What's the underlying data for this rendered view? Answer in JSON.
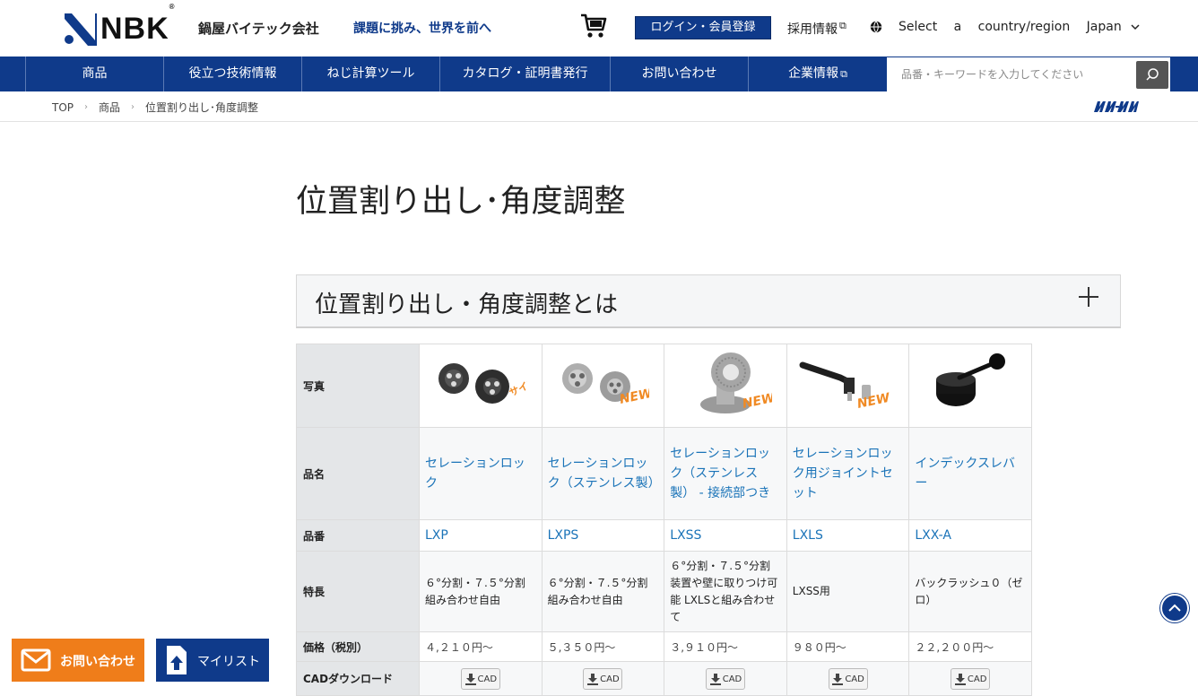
{
  "header": {
    "logo_text": "NBK",
    "logo_mark": "®",
    "company": "鍋屋バイテック会社",
    "tagline": "課題に挑み、世界を前へ",
    "login_label": "ログイン・会員登録",
    "recruit_label": "採用情報",
    "region_label": "Select a country/region",
    "region_value": "Japan"
  },
  "nav": {
    "items": [
      "商品",
      "役立つ技術情報",
      "ねじ計算ツール",
      "カタログ・証明書発行",
      "お問い合わせ",
      "企業情報"
    ],
    "search_placeholder": "品番・キーワードを入力してください"
  },
  "breadcrumb": [
    "TOP",
    "商品",
    "位置割り出し･角度調整"
  ],
  "page": {
    "title": "位置割り出し･角度調整",
    "accordion_title": "位置割り出し・角度調整とは"
  },
  "table": {
    "row_labels": {
      "photo": "写真",
      "name": "品名",
      "code": "品番",
      "feature": "特長",
      "price": "価格（税別）",
      "cad": "CADダウンロード"
    },
    "cad_label": "CAD",
    "products": [
      {
        "badge": "サイズ追加",
        "name": "セレーションロック",
        "code": "LXP",
        "feature": "６°分割・７.５°分割 組み合わせ自由",
        "price": "４,２１０円～"
      },
      {
        "badge": "NEW",
        "name": "セレーションロック（ステンレス製）",
        "code": "LXPS",
        "feature": "６°分割・７.５°分割 組み合わせ自由",
        "price": "５,３５０円～"
      },
      {
        "badge": "NEW",
        "name": "セレーションロック（ステンレス製） - 接続部つき",
        "code": "LXSS",
        "feature": "６°分割・７.５°分割 装置や壁に取りつけ可能 LXLSと組み合わせて",
        "price": "３,９１０円～"
      },
      {
        "badge": "NEW",
        "name": "セレーションロック用ジョイントセット",
        "code": "LXLS",
        "feature": "LXSS用",
        "price": "９８０円～"
      },
      {
        "badge": "",
        "name": "インデックスレバー",
        "code": "LXX-A",
        "feature": "バックラッシュ０（ゼロ）",
        "price": "２２,２００円～"
      }
    ]
  },
  "floating": {
    "contact_label": "お問い合わせ",
    "mylist_label": "マイリスト"
  },
  "colors": {
    "brand_navy": "#0f3a8a",
    "link_blue": "#1a73b8",
    "contact_orange": "#ef7d1a",
    "badge_orange": "#f08a24"
  }
}
